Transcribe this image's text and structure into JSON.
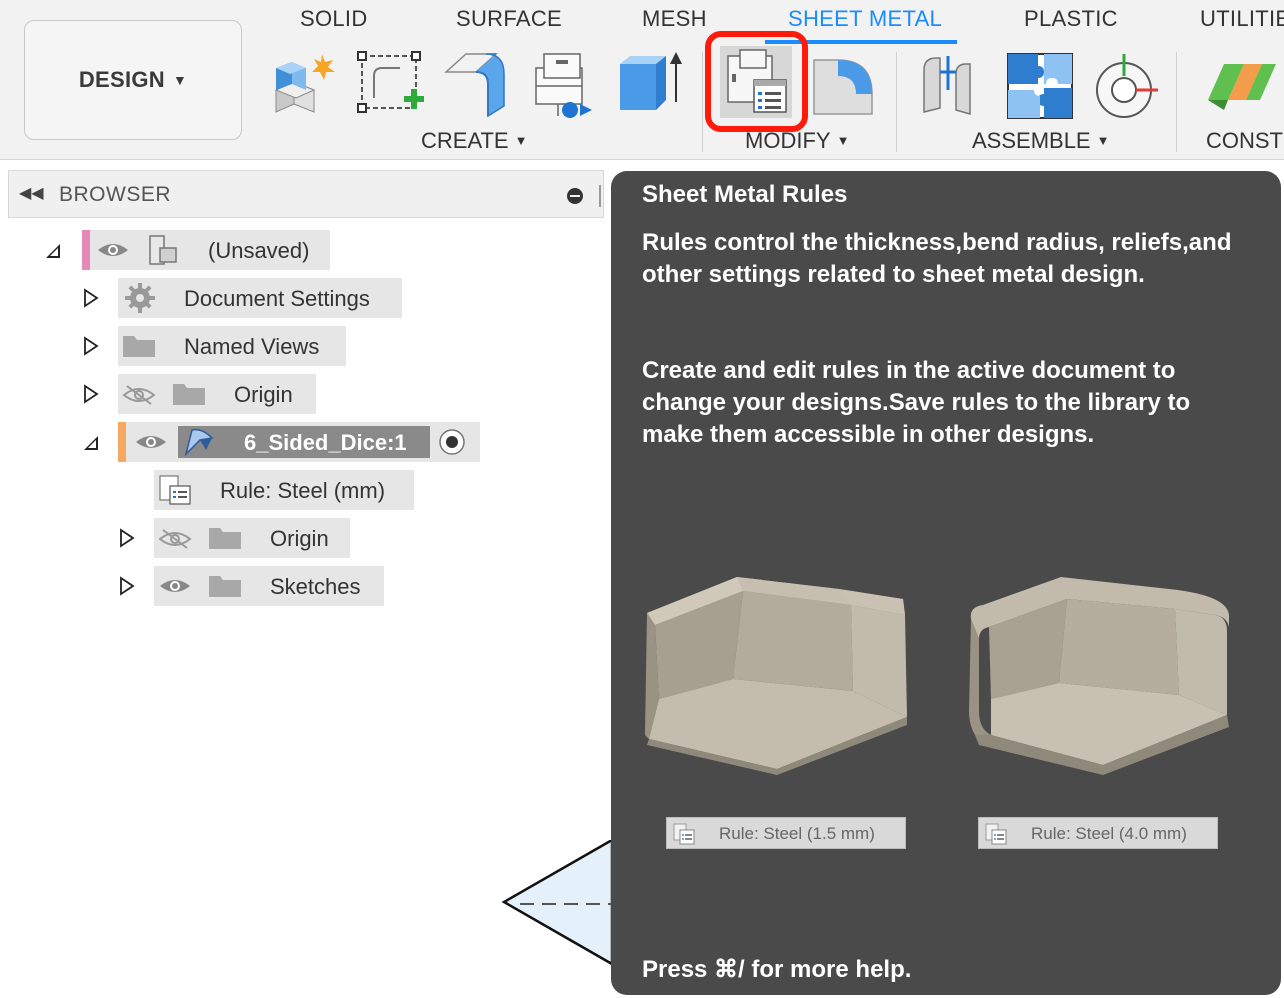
{
  "workspace": {
    "label": "DESIGN"
  },
  "tabs": [
    {
      "label": "SOLID",
      "active": false
    },
    {
      "label": "SURFACE",
      "active": false
    },
    {
      "label": "MESH",
      "active": false
    },
    {
      "label": "SHEET METAL",
      "active": true
    },
    {
      "label": "PLASTIC",
      "active": false
    },
    {
      "label": "UTILITIE",
      "active": false
    }
  ],
  "groups": {
    "create": "CREATE",
    "modify": "MODIFY",
    "assemble": "ASSEMBLE",
    "construct": "CONSTI"
  },
  "browser": {
    "title": "BROWSER",
    "root_label": "(Unsaved)",
    "document_settings": "Document Settings",
    "named_views": "Named Views",
    "origin": "Origin",
    "component": "6_Sided_Dice:1",
    "rule": "Rule: Steel (mm)",
    "sub_origin": "Origin",
    "sketches": "Sketches"
  },
  "tooltip": {
    "title": "Sheet Metal Rules",
    "description": "Rules control the thickness,bend radius, reliefs,and other settings related to sheet metal design.",
    "description2": "Create and edit rules in the active document to change your designs.Save rules to the library to make them accessible in other designs.",
    "rule_thin": "Rule: Steel (1.5 mm)",
    "rule_thick": "Rule: Steel (4.0 mm)",
    "help": "Press ⌘/ for more help."
  },
  "colors": {
    "accent": "#1a8cff",
    "highlight": "#ff1a0a",
    "tooltip_bg": "#4a4a4a",
    "root_marker": "#e58ab8",
    "component_marker": "#f4a860"
  },
  "icons": [
    "new-component-icon",
    "create-sketch-icon",
    "flange-icon",
    "sheet-metal-rules-icon",
    "extrude-icon",
    "bend-icon",
    "joint-icon",
    "assemble-icon",
    "motion-icon",
    "plane-icon",
    "eye-icon",
    "eye-hidden-icon",
    "gear-icon",
    "folder-icon",
    "component-icon",
    "rule-icon",
    "radio-icon"
  ]
}
